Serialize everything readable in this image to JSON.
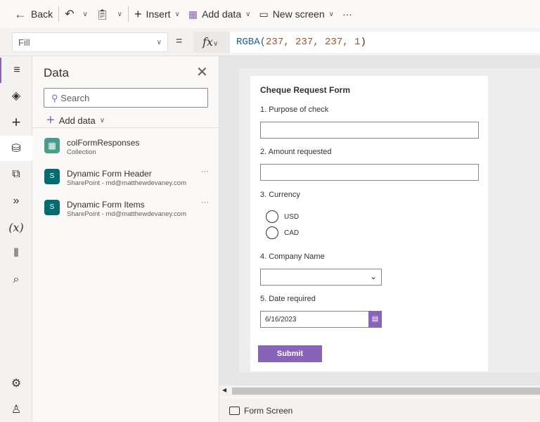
{
  "toolbar": {
    "back": "Back",
    "insert": "Insert",
    "add_data": "Add data",
    "new_screen": "New screen",
    "more": "···"
  },
  "formula_bar": {
    "property": "Fill",
    "equals": "=",
    "fx": "fx",
    "formula_fn": "RGBA(",
    "formula_args": "237, 237, 237, 1",
    "formula_close": ")"
  },
  "data_panel": {
    "title": "Data",
    "search_placeholder": "Search",
    "add_data": "Add data",
    "items": [
      {
        "name": "colFormResponses",
        "sub": "Collection"
      },
      {
        "name": "Dynamic Form Header",
        "sub": "SharePoint - md@matthewdevaney.com"
      },
      {
        "name": "Dynamic Form Items",
        "sub": "SharePoint - md@matthewdevaney.com"
      }
    ]
  },
  "form": {
    "title": "Cheque Request Form",
    "q1": "1. Purpose of check",
    "q2": "2. Amount requested",
    "q3": "3. Currency",
    "opt1": "USD",
    "opt2": "CAD",
    "q4": "4. Company Name",
    "q5": "5. Date required",
    "date": "6/16/2023",
    "submit": "Submit"
  },
  "footer": {
    "screen": "Form Screen"
  },
  "colors": {
    "accent": "#8764b8",
    "canvas": "#ededed"
  }
}
